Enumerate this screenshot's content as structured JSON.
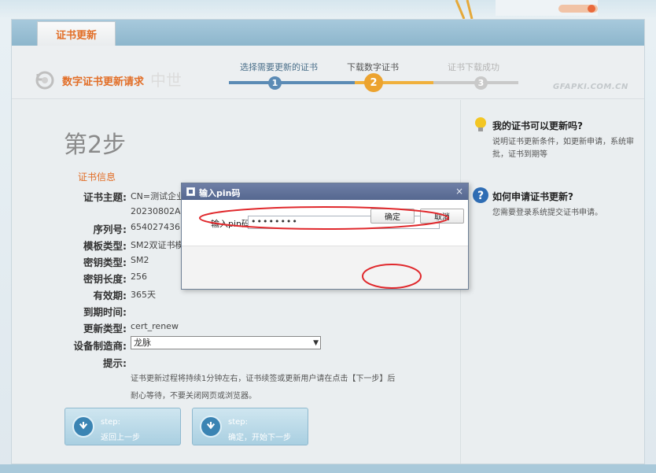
{
  "tab": {
    "label": "证书更新"
  },
  "header": {
    "title": "数字证书更新请求",
    "watermark": "GFAPKI.COM.CN",
    "watermark_cn": "中世"
  },
  "stepper": {
    "steps": [
      {
        "label": "选择需要更新的证书",
        "number": "1",
        "state": "done"
      },
      {
        "label": "下载数字证书",
        "number": "2",
        "state": "current"
      },
      {
        "label": "证书下载成功",
        "number": "3",
        "state": "pending"
      }
    ]
  },
  "main": {
    "step_heading": "第2步",
    "section_title": "证书信息",
    "fields": {
      "subject": {
        "label": "证书主题:",
        "value": "CN=测试企业",
        "value2": "20230802A,O"
      },
      "serial": {
        "label": "序列号:",
        "value": "654027436B3"
      },
      "template": {
        "label": "模板类型:",
        "value": "SM2双证书模板"
      },
      "key_type": {
        "label": "密钥类型:",
        "value": "SM2"
      },
      "key_length": {
        "label": "密钥长度:",
        "value": "256"
      },
      "validity": {
        "label": "有效期:",
        "value": "365天"
      },
      "expiry": {
        "label": "到期时间:",
        "value": ""
      },
      "update_type": {
        "label": "更新类型:",
        "value": "cert_renew"
      },
      "manufacturer": {
        "label": "设备制造商:",
        "value": "龙脉"
      },
      "tip": {
        "label": "提示:",
        "line1": "证书更新过程将持续1分钟左右，证书续签或更新用户请在点击【下一步】后",
        "line2": "耐心等待，不要关闭网页或浏览器。"
      }
    },
    "buttons": {
      "prev": {
        "small": "step:",
        "label": "返回上一步"
      },
      "next": {
        "small": "step:",
        "label": "确定，开始下一步"
      }
    }
  },
  "sidebar": {
    "help1": {
      "title": "我的证书可以更新吗?",
      "text": "说明证书更新条件，如更新申请，系统审批，证书到期等"
    },
    "help2": {
      "title": "如何申请证书更新?",
      "text": "您需要登录系统提交证书申请。"
    }
  },
  "dialog": {
    "title": "输入pin码",
    "close": "×",
    "pin_label": "输入pin码:",
    "pin_value": "••••••••",
    "ok_label": "确定",
    "cancel_label": "取消"
  },
  "colors": {
    "accent": "#e26e27",
    "step_done": "#5b8bb5",
    "step_current": "#eca32f",
    "step_pending": "#c9c9c9",
    "annotation": "#e0282c"
  }
}
